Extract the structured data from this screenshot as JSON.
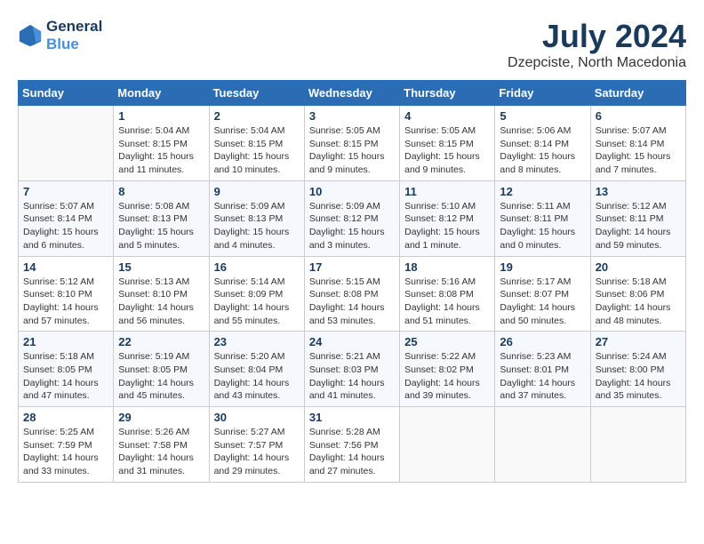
{
  "header": {
    "logo_line1": "General",
    "logo_line2": "Blue",
    "title": "July 2024",
    "subtitle": "Dzepciste, North Macedonia"
  },
  "days_of_week": [
    "Sunday",
    "Monday",
    "Tuesday",
    "Wednesday",
    "Thursday",
    "Friday",
    "Saturday"
  ],
  "weeks": [
    [
      {
        "day": "",
        "info": ""
      },
      {
        "day": "1",
        "info": "Sunrise: 5:04 AM\nSunset: 8:15 PM\nDaylight: 15 hours\nand 11 minutes."
      },
      {
        "day": "2",
        "info": "Sunrise: 5:04 AM\nSunset: 8:15 PM\nDaylight: 15 hours\nand 10 minutes."
      },
      {
        "day": "3",
        "info": "Sunrise: 5:05 AM\nSunset: 8:15 PM\nDaylight: 15 hours\nand 9 minutes."
      },
      {
        "day": "4",
        "info": "Sunrise: 5:05 AM\nSunset: 8:15 PM\nDaylight: 15 hours\nand 9 minutes."
      },
      {
        "day": "5",
        "info": "Sunrise: 5:06 AM\nSunset: 8:14 PM\nDaylight: 15 hours\nand 8 minutes."
      },
      {
        "day": "6",
        "info": "Sunrise: 5:07 AM\nSunset: 8:14 PM\nDaylight: 15 hours\nand 7 minutes."
      }
    ],
    [
      {
        "day": "7",
        "info": "Sunrise: 5:07 AM\nSunset: 8:14 PM\nDaylight: 15 hours\nand 6 minutes."
      },
      {
        "day": "8",
        "info": "Sunrise: 5:08 AM\nSunset: 8:13 PM\nDaylight: 15 hours\nand 5 minutes."
      },
      {
        "day": "9",
        "info": "Sunrise: 5:09 AM\nSunset: 8:13 PM\nDaylight: 15 hours\nand 4 minutes."
      },
      {
        "day": "10",
        "info": "Sunrise: 5:09 AM\nSunset: 8:12 PM\nDaylight: 15 hours\nand 3 minutes."
      },
      {
        "day": "11",
        "info": "Sunrise: 5:10 AM\nSunset: 8:12 PM\nDaylight: 15 hours\nand 1 minute."
      },
      {
        "day": "12",
        "info": "Sunrise: 5:11 AM\nSunset: 8:11 PM\nDaylight: 15 hours\nand 0 minutes."
      },
      {
        "day": "13",
        "info": "Sunrise: 5:12 AM\nSunset: 8:11 PM\nDaylight: 14 hours\nand 59 minutes."
      }
    ],
    [
      {
        "day": "14",
        "info": "Sunrise: 5:12 AM\nSunset: 8:10 PM\nDaylight: 14 hours\nand 57 minutes."
      },
      {
        "day": "15",
        "info": "Sunrise: 5:13 AM\nSunset: 8:10 PM\nDaylight: 14 hours\nand 56 minutes."
      },
      {
        "day": "16",
        "info": "Sunrise: 5:14 AM\nSunset: 8:09 PM\nDaylight: 14 hours\nand 55 minutes."
      },
      {
        "day": "17",
        "info": "Sunrise: 5:15 AM\nSunset: 8:08 PM\nDaylight: 14 hours\nand 53 minutes."
      },
      {
        "day": "18",
        "info": "Sunrise: 5:16 AM\nSunset: 8:08 PM\nDaylight: 14 hours\nand 51 minutes."
      },
      {
        "day": "19",
        "info": "Sunrise: 5:17 AM\nSunset: 8:07 PM\nDaylight: 14 hours\nand 50 minutes."
      },
      {
        "day": "20",
        "info": "Sunrise: 5:18 AM\nSunset: 8:06 PM\nDaylight: 14 hours\nand 48 minutes."
      }
    ],
    [
      {
        "day": "21",
        "info": "Sunrise: 5:18 AM\nSunset: 8:05 PM\nDaylight: 14 hours\nand 47 minutes."
      },
      {
        "day": "22",
        "info": "Sunrise: 5:19 AM\nSunset: 8:05 PM\nDaylight: 14 hours\nand 45 minutes."
      },
      {
        "day": "23",
        "info": "Sunrise: 5:20 AM\nSunset: 8:04 PM\nDaylight: 14 hours\nand 43 minutes."
      },
      {
        "day": "24",
        "info": "Sunrise: 5:21 AM\nSunset: 8:03 PM\nDaylight: 14 hours\nand 41 minutes."
      },
      {
        "day": "25",
        "info": "Sunrise: 5:22 AM\nSunset: 8:02 PM\nDaylight: 14 hours\nand 39 minutes."
      },
      {
        "day": "26",
        "info": "Sunrise: 5:23 AM\nSunset: 8:01 PM\nDaylight: 14 hours\nand 37 minutes."
      },
      {
        "day": "27",
        "info": "Sunrise: 5:24 AM\nSunset: 8:00 PM\nDaylight: 14 hours\nand 35 minutes."
      }
    ],
    [
      {
        "day": "28",
        "info": "Sunrise: 5:25 AM\nSunset: 7:59 PM\nDaylight: 14 hours\nand 33 minutes."
      },
      {
        "day": "29",
        "info": "Sunrise: 5:26 AM\nSunset: 7:58 PM\nDaylight: 14 hours\nand 31 minutes."
      },
      {
        "day": "30",
        "info": "Sunrise: 5:27 AM\nSunset: 7:57 PM\nDaylight: 14 hours\nand 29 minutes."
      },
      {
        "day": "31",
        "info": "Sunrise: 5:28 AM\nSunset: 7:56 PM\nDaylight: 14 hours\nand 27 minutes."
      },
      {
        "day": "",
        "info": ""
      },
      {
        "day": "",
        "info": ""
      },
      {
        "day": "",
        "info": ""
      }
    ]
  ]
}
